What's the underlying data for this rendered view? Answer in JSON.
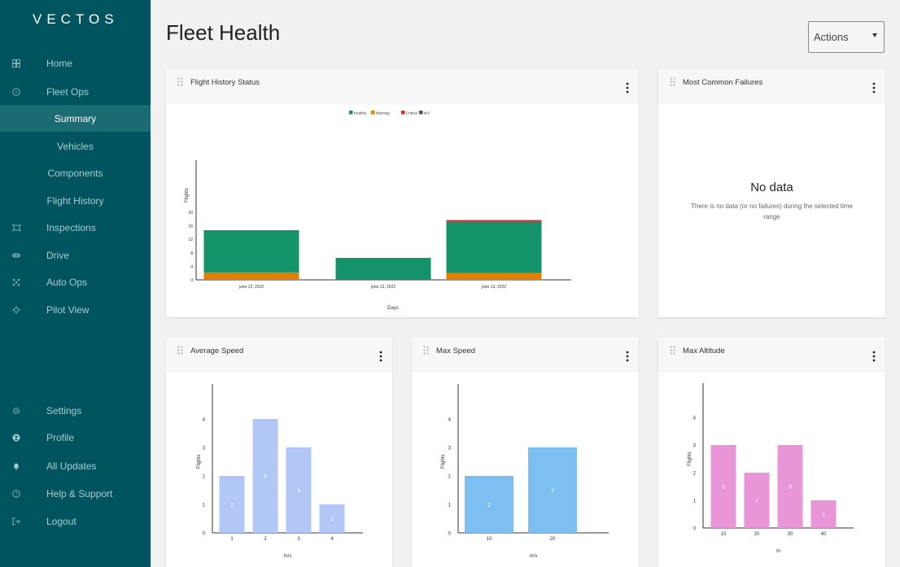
{
  "app": {
    "logo_text": "VECTOS",
    "page_title": "Fleet Health",
    "actions_label": "Actions"
  },
  "sidebar": {
    "items": [
      {
        "label": "Home",
        "icon": "dashboard-icon"
      },
      {
        "label": "Fleet Ops",
        "icon": "compass-icon"
      },
      {
        "label": "Summary",
        "sub": true,
        "active": true
      },
      {
        "label": "Vehicles",
        "sub": true
      },
      {
        "label": "Components",
        "sub": true
      },
      {
        "label": "Flight History",
        "sub": true
      },
      {
        "label": "Inspections",
        "icon": "inspection-icon"
      },
      {
        "label": "Drive",
        "icon": "drive-icon"
      },
      {
        "label": "Auto Ops",
        "icon": "auto-ops-icon"
      },
      {
        "label": "Pilot View",
        "icon": "pilot-icon"
      },
      {
        "label": "Settings",
        "icon": "gear-icon"
      },
      {
        "label": "Profile",
        "icon": "user-icon"
      },
      {
        "label": "All Updates",
        "icon": "bell-icon"
      },
      {
        "label": "Help & Support",
        "icon": "help-icon"
      },
      {
        "label": "Logout",
        "icon": "logout-icon"
      }
    ]
  },
  "cards": {
    "flight_history": {
      "title": "Flight History Status"
    },
    "failures": {
      "title": "Most Common Failures",
      "empty_title": "No data",
      "empty_text": "There is no data (or no failures) during the selected time range"
    },
    "avg_speed": {
      "title": "Average Speed"
    },
    "max_speed": {
      "title": "Max Speed"
    },
    "max_altitude": {
      "title": "Max Altitude"
    }
  },
  "colors": {
    "sidebar": "#00545f",
    "healthy": "#14936b",
    "warning": "#e07f00",
    "critical": "#d42b2b",
    "na": "#555555",
    "avg_speed_bar": "#b3c7f7",
    "max_speed_bar": "#7dbff1",
    "altitude_bar": "#e896d7"
  },
  "chart_data": [
    {
      "id": "flight-history",
      "type": "bar",
      "stacked": true,
      "categories": [
        "june 12, 2022",
        "june 13, 2022",
        "june 13, 2022"
      ],
      "series": [
        {
          "name": "Healthy",
          "values": [
            12.5,
            6.5,
            15.2
          ]
        },
        {
          "name": "Warning",
          "values": [
            2.2,
            0,
            2.0
          ]
        },
        {
          "name": "Critical",
          "values": [
            0,
            0,
            0.5
          ]
        },
        {
          "name": "N/A",
          "values": [
            0,
            0,
            0
          ]
        }
      ],
      "xlabel": "Days",
      "ylabel": "Flights",
      "yticks": [
        0,
        4,
        8,
        12,
        16,
        20
      ],
      "ylim": [
        0,
        20
      ],
      "legend": "top-center"
    },
    {
      "id": "avg-speed",
      "type": "bar",
      "categories": [
        "1",
        "2",
        "3",
        "4"
      ],
      "values": [
        2,
        4,
        3,
        1
      ],
      "xlabel": "m/s",
      "ylabel": "Flights",
      "yticks": [
        0,
        1,
        2,
        3,
        4
      ],
      "ylim": [
        0,
        5
      ]
    },
    {
      "id": "max-speed",
      "type": "bar",
      "categories": [
        "10",
        "20"
      ],
      "values": [
        2,
        3
      ],
      "xlabel": "m/s",
      "ylabel": "Flights",
      "yticks": [
        0,
        1,
        2,
        3,
        4
      ],
      "ylim": [
        0,
        5
      ]
    },
    {
      "id": "max-altitude",
      "type": "bar",
      "categories": [
        "10",
        "20",
        "30",
        "40"
      ],
      "values": [
        3,
        2,
        3,
        1
      ],
      "xlabel": "m",
      "ylabel": "Flights",
      "yticks": [
        0,
        1,
        2,
        3,
        4
      ],
      "ylim": [
        0,
        5
      ]
    }
  ]
}
